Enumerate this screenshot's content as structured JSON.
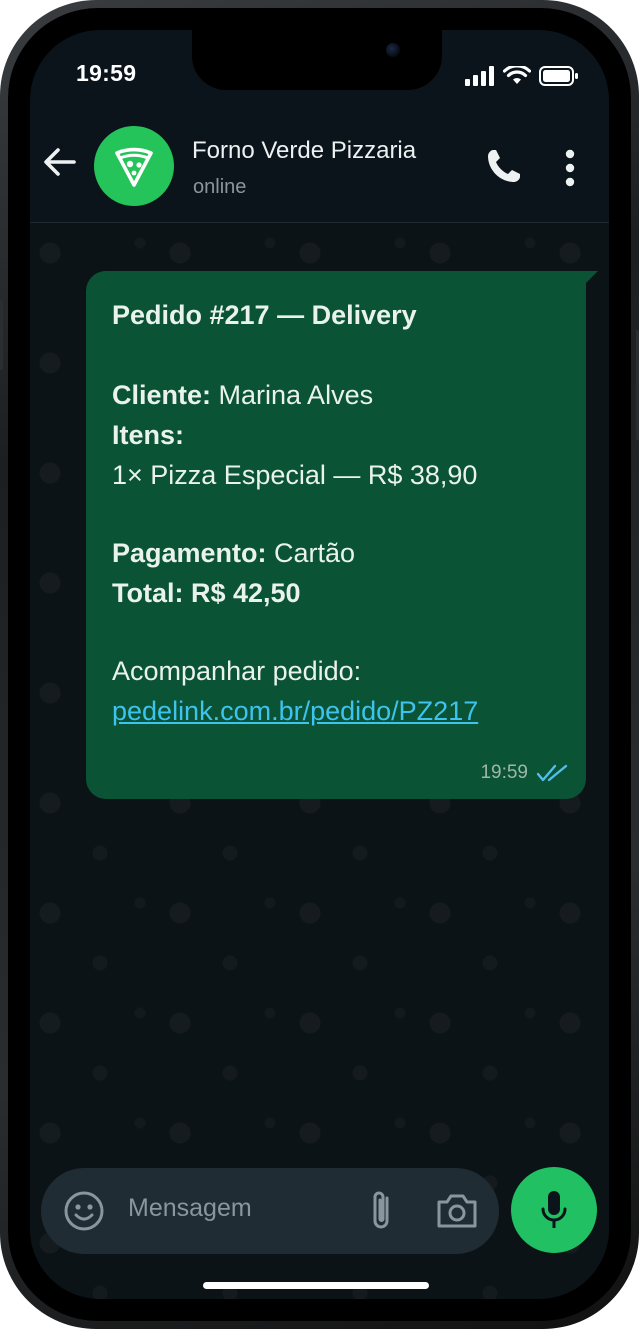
{
  "status_bar": {
    "time": "19:59"
  },
  "header": {
    "contact_name": "Forno Verde Pizzaria",
    "contact_status": "online",
    "avatar_icon": "pizza-slice-icon"
  },
  "message": {
    "title": "Pedido #217 — Delivery",
    "customer_label": "Cliente:",
    "customer_value": " Marina Alves",
    "items_label": "Itens:",
    "item_line": "1× Pizza Especial — R$ 38,90",
    "payment_label": "Pagamento:",
    "payment_value": " Cartão",
    "total_text": "Total: R$ 42,50",
    "track_label": "Acompanhar pedido:",
    "track_link": "pedelink.com.br/pedido/PZ217",
    "timestamp": "19:59",
    "read_status": "double-check-icon"
  },
  "composer": {
    "placeholder": "Mensagem"
  },
  "colors": {
    "bubble": "#0a5334",
    "link": "#3ec3ee",
    "accent_green": "#21c063",
    "read_ticks": "#53bdeb"
  }
}
